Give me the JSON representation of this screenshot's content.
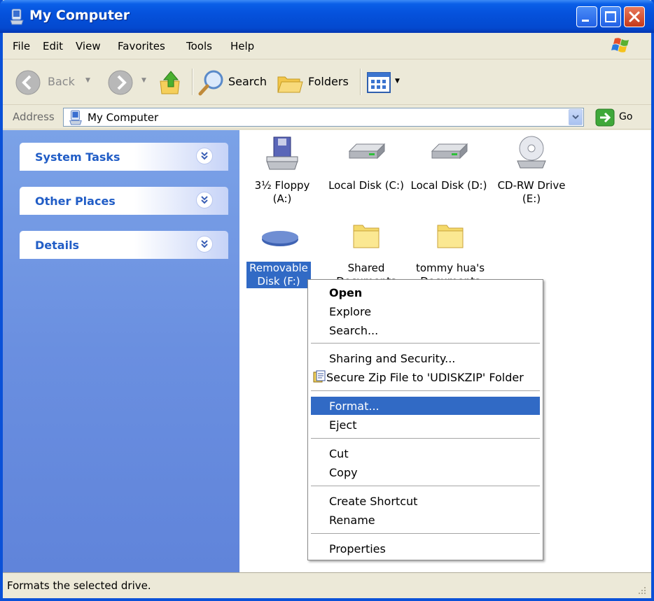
{
  "window": {
    "title": "My Computer"
  },
  "menu": [
    "File",
    "Edit",
    "View",
    "Favorites",
    "Tools",
    "Help"
  ],
  "toolbar": {
    "back": "Back",
    "search": "Search",
    "folders": "Folders"
  },
  "address": {
    "label": "Address",
    "value": "My Computer",
    "go": "Go"
  },
  "left_pane": {
    "panels": [
      "System Tasks",
      "Other Places",
      "Details"
    ]
  },
  "drives": [
    {
      "line1": "3½ Floppy",
      "line2": "(A:)"
    },
    {
      "line1": "Local Disk (C:)",
      "line2": ""
    },
    {
      "line1": "Local Disk (D:)",
      "line2": ""
    },
    {
      "line1": "CD-RW Drive",
      "line2": "(E:)"
    },
    {
      "line1": "Removable",
      "line2": "Disk (F:)"
    },
    {
      "line1": "Shared",
      "line2": "Documents"
    },
    {
      "line1": "tommy hua's",
      "line2": "Documents"
    }
  ],
  "context_menu": {
    "open": "Open",
    "explore": "Explore",
    "search": "Search...",
    "sharing": "Sharing and Security...",
    "zip": "Secure Zip File to 'UDISKZIP' Folder",
    "format": "Format...",
    "eject": "Eject",
    "cut": "Cut",
    "copy": "Copy",
    "create_shortcut": "Create Shortcut",
    "rename": "Rename",
    "properties": "Properties"
  },
  "status": {
    "text": "Formats the selected drive."
  },
  "colors": {
    "title_blue": "#0552dc",
    "task_pane": "#6a8fe0",
    "highlight": "#316ac5",
    "task_title": "#215dc6"
  }
}
